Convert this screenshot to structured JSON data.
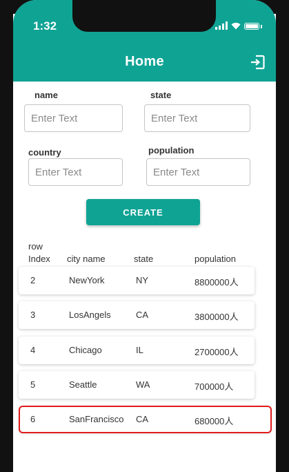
{
  "status_bar": {
    "time": "1:32"
  },
  "header": {
    "title": "Home",
    "logout_icon": "logout-icon"
  },
  "form": {
    "fields": [
      {
        "label": "name",
        "placeholder": "Enter Text",
        "value": ""
      },
      {
        "label": "state",
        "placeholder": "Enter Text",
        "value": ""
      },
      {
        "label": "country",
        "placeholder": "Enter Text",
        "value": ""
      },
      {
        "label": "population",
        "placeholder": "Enter Text",
        "value": ""
      }
    ],
    "create_label": "CREATE"
  },
  "table": {
    "columns": [
      "row\nIndex",
      "city name",
      "state",
      "population"
    ],
    "rows": [
      {
        "index": "2",
        "city": "NewYork",
        "state": "NY",
        "population": "8800000人"
      },
      {
        "index": "3",
        "city": "LosAngels",
        "state": "CA",
        "population": "3800000人"
      },
      {
        "index": "4",
        "city": "Chicago",
        "state": "IL",
        "population": "2700000人"
      },
      {
        "index": "5",
        "city": "Seattle",
        "state": "WA",
        "population": "700000人"
      },
      {
        "index": "6",
        "city": "SanFrancisco",
        "state": "CA",
        "population": "680000人"
      }
    ],
    "selected_row_index": 4
  },
  "colors": {
    "accent": "#0fa394",
    "highlight": "#e21b1b"
  }
}
